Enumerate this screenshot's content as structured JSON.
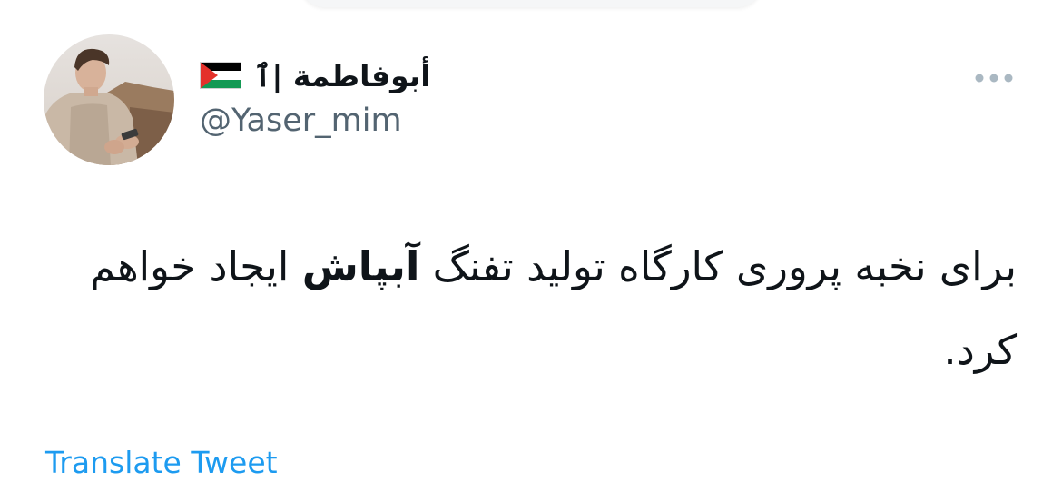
{
  "author": {
    "display_name": "أبوفاطمة",
    "name_symbol": "|ٱ",
    "handle": "@Yaser_mim",
    "flag_icon": "palestine-flag-icon"
  },
  "tweet": {
    "text_before": "برای نخبه پروری کارگاه تولید تفنگ ",
    "text_bold": "آبپاش",
    "text_after": " ایجاد خواهم کرد."
  },
  "actions": {
    "more_icon": "more-dots-icon",
    "translate_label": "Translate Tweet"
  },
  "colors": {
    "text": "#0f1419",
    "secondary_text": "#536471",
    "link": "#1d9bf0",
    "more_dots": "#aab8c2"
  }
}
